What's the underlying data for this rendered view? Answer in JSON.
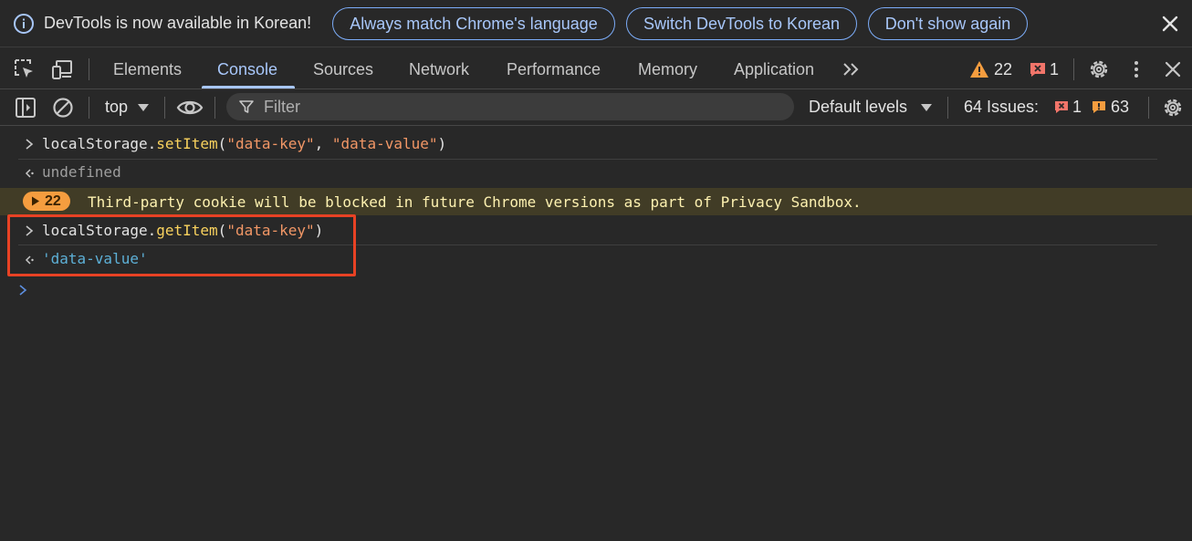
{
  "infobar": {
    "message": "DevTools is now available in Korean!",
    "btn_match": "Always match Chrome's language",
    "btn_switch": "Switch DevTools to Korean",
    "btn_dismiss": "Don't show again"
  },
  "tabs": {
    "elements": "Elements",
    "console": "Console",
    "sources": "Sources",
    "network": "Network",
    "performance": "Performance",
    "memory": "Memory",
    "application": "Application"
  },
  "counts": {
    "warnings": "22",
    "errors": "1"
  },
  "console_toolbar": {
    "context": "top",
    "filter_placeholder": "Filter",
    "levels": "Default levels",
    "issues_label": "64 Issues:",
    "issues_errors": "1",
    "issues_warnings": "63"
  },
  "console": {
    "line1": {
      "obj": "localStorage.",
      "method": "setItem",
      "open": "(",
      "arg1": "\"data-key\"",
      "comma": ", ",
      "arg2": "\"data-value\"",
      "close": ")"
    },
    "result1": "undefined",
    "warning": {
      "count": "22",
      "text": "Third-party cookie will be blocked in future Chrome versions as part of Privacy Sandbox."
    },
    "line2": {
      "obj": "localStorage.",
      "method": "getItem",
      "open": "(",
      "arg1": "\"data-key\"",
      "close": ")"
    },
    "result2": "'data-value'"
  },
  "colors": {
    "accent": "#a8c7fa",
    "highlight": "#e84224",
    "warning": "#f59d3f",
    "error": "#f2756a"
  }
}
